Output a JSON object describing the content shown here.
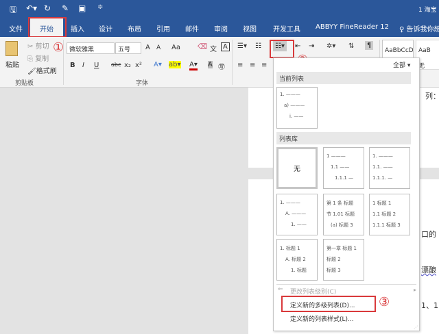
{
  "titlebar": {
    "title": "1 海宝",
    "qat": [
      "save-icon",
      "undo-icon",
      "redo-icon",
      "format-painter-icon",
      "preview-icon",
      "customize-icon"
    ]
  },
  "tabs": [
    "文件",
    "开始",
    "插入",
    "设计",
    "布局",
    "引用",
    "邮件",
    "审阅",
    "视图",
    "开发工具",
    "ABBYY FineReader 12"
  ],
  "tell_me": "告诉我你想",
  "clipboard": {
    "paste": "粘贴",
    "cut": "剪切",
    "copy": "复制",
    "format_painter": "格式刷",
    "group": "剪贴板"
  },
  "font": {
    "name": "微软雅黑",
    "size": "五号",
    "grow": "A",
    "shrink": "A",
    "case": "Aa",
    "group": "字体",
    "bold": "B",
    "italic": "I",
    "underline": "U",
    "strike": "abc",
    "sub": "x₂",
    "sup": "x²"
  },
  "styles": {
    "sample1": "AaBbCcD",
    "sample2": "AaB",
    "style2": "无"
  },
  "annotations": [
    "①",
    "②",
    "③"
  ],
  "menu": {
    "filter": "全部",
    "current_header": "当前列表",
    "library_header": "列表库",
    "none": "无",
    "current": [
      "1.",
      "a)",
      "i."
    ],
    "lib": [
      [
        "1",
        "1.1",
        "1.1.1"
      ],
      [
        "1.",
        "1.1.",
        "1.1.1."
      ],
      [
        "1.",
        "A.",
        "1."
      ],
      [
        "第 1 条 标题",
        "节 1.01 标题",
        "(a) 标题 3"
      ],
      [
        "1 标题 1",
        "1.1 标题 2",
        "1.1.1 标题 3"
      ],
      [
        "1. 标题 1",
        "A. 标题 2",
        "1. 标题"
      ],
      [
        "第一章 标题 1",
        "标题 2",
        "标题 3"
      ]
    ],
    "change_level": "更改列表级别(C)",
    "define_multi": "定义新的多级列表(D)...",
    "define_style": "定义新的列表样式(L)..."
  },
  "document": {
    "snippets": [
      "列：",
      "口的",
      "漂酿",
      "1、1"
    ]
  }
}
